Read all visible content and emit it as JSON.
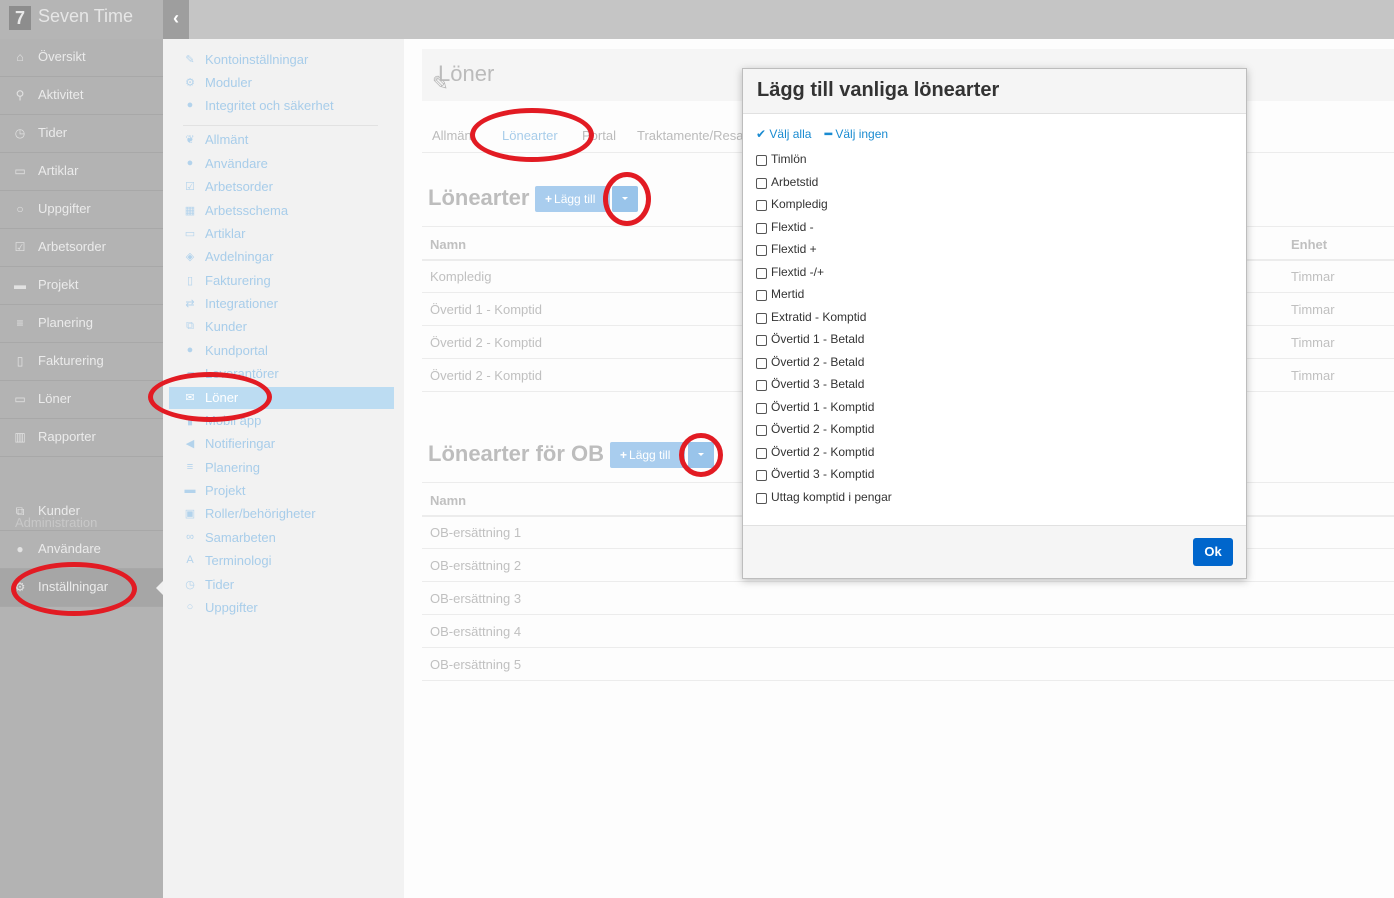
{
  "app": {
    "logo_mark": "7",
    "name": "Seven Time",
    "collapse_icon": "chevron-left-icon"
  },
  "leftnav": {
    "items": [
      {
        "label": "Översikt",
        "icon": "home-icon",
        "glyph": "⌂"
      },
      {
        "label": "Aktivitet",
        "icon": "map-marker-icon",
        "glyph": "⚲"
      },
      {
        "label": "Tider",
        "icon": "clock-icon",
        "glyph": "◷"
      },
      {
        "label": "Artiklar",
        "icon": "money-icon",
        "glyph": "▭"
      },
      {
        "label": "Uppgifter",
        "icon": "circle-icon",
        "glyph": "○"
      },
      {
        "label": "Arbetsorder",
        "icon": "check-square-icon",
        "glyph": "☑"
      },
      {
        "label": "Projekt",
        "icon": "briefcase-icon",
        "glyph": "▬"
      },
      {
        "label": "Planering",
        "icon": "list-icon",
        "glyph": "≡"
      },
      {
        "label": "Fakturering",
        "icon": "file-icon",
        "glyph": "▯"
      },
      {
        "label": "Löner",
        "icon": "money-icon",
        "glyph": "▭"
      },
      {
        "label": "Rapporter",
        "icon": "bar-chart-icon",
        "glyph": "▥"
      }
    ],
    "admin_title": "Administration",
    "admin_items": [
      {
        "label": "Kunder",
        "icon": "sitemap-icon",
        "glyph": "⧉"
      },
      {
        "label": "Användare",
        "icon": "user-icon",
        "glyph": "●"
      },
      {
        "label": "Inställningar",
        "icon": "gear-icon",
        "glyph": "⚙"
      }
    ]
  },
  "settings_menu": {
    "items": [
      {
        "label": "Kontoinställningar",
        "icon": "wrench-icon",
        "glyph": "✎"
      },
      {
        "label": "Moduler",
        "icon": "cogs-icon",
        "glyph": "⚙"
      },
      {
        "label": "Integritet och säkerhet",
        "icon": "circle-icon",
        "glyph": "●"
      },
      {
        "label": "Allmänt",
        "icon": "leaf-icon",
        "glyph": "❦"
      },
      {
        "label": "Användare",
        "icon": "user-icon",
        "glyph": "●"
      },
      {
        "label": "Arbetsorder",
        "icon": "check-square-icon",
        "glyph": "☑"
      },
      {
        "label": "Arbetsschema",
        "icon": "calendar-icon",
        "glyph": "▦"
      },
      {
        "label": "Artiklar",
        "icon": "money-icon",
        "glyph": "▭"
      },
      {
        "label": "Avdelningar",
        "icon": "tag-icon",
        "glyph": "◈"
      },
      {
        "label": "Fakturering",
        "icon": "file-icon",
        "glyph": "▯"
      },
      {
        "label": "Integrationer",
        "icon": "exchange-icon",
        "glyph": "⇄"
      },
      {
        "label": "Kunder",
        "icon": "sitemap-icon",
        "glyph": "⧉"
      },
      {
        "label": "Kundportal",
        "icon": "users-icon",
        "glyph": "●"
      },
      {
        "label": "Leverantörer",
        "icon": "truck-icon",
        "glyph": "▰"
      },
      {
        "label": "Löner",
        "icon": "envelope-icon",
        "glyph": "✉"
      },
      {
        "label": "Mobil app",
        "icon": "mobile-icon",
        "glyph": "▮"
      },
      {
        "label": "Notifieringar",
        "icon": "bullhorn-icon",
        "glyph": "◀"
      },
      {
        "label": "Planering",
        "icon": "list-icon",
        "glyph": "≡"
      },
      {
        "label": "Projekt",
        "icon": "briefcase-icon",
        "glyph": "▬"
      },
      {
        "label": "Roller/behörigheter",
        "icon": "lock-icon",
        "glyph": "▣"
      },
      {
        "label": "Samarbeten",
        "icon": "handshake-icon",
        "glyph": "∞"
      },
      {
        "label": "Terminologi",
        "icon": "font-icon",
        "glyph": "A"
      },
      {
        "label": "Tider",
        "icon": "clock-icon",
        "glyph": "◷"
      },
      {
        "label": "Uppgifter",
        "icon": "circle-icon",
        "glyph": "○"
      }
    ]
  },
  "main": {
    "title": "Löner",
    "tabs": [
      "Allmänt",
      "Lönearter",
      "Portal",
      "Traktamente/Resa"
    ],
    "section1": {
      "title": "Lönearter",
      "add_label": "Lägg till",
      "columns": {
        "name": "Namn",
        "unit": "Enhet"
      },
      "rows": [
        {
          "name": "Kompledig",
          "unit": "Timmar"
        },
        {
          "name": "Övertid 1 - Komptid",
          "unit": "Timmar"
        },
        {
          "name": "Övertid 2 - Komptid",
          "unit": "Timmar"
        },
        {
          "name": "Övertid 2 - Komptid",
          "unit": "Timmar"
        }
      ]
    },
    "section2": {
      "title": "Lönearter för OB",
      "add_label": "Lägg till",
      "columns": {
        "name": "Namn"
      },
      "rows": [
        "OB-ersättning 1",
        "OB-ersättning 2",
        "OB-ersättning 3",
        "OB-ersättning 4",
        "OB-ersättning 5"
      ]
    }
  },
  "modal": {
    "title": "Lägg till vanliga lönearter",
    "select_all": "Välj alla",
    "select_none": "Välj ingen",
    "options": [
      "Timlön",
      "Arbetstid",
      "Kompledig",
      "Flextid -",
      "Flextid +",
      "Flextid -/+",
      "Mertid",
      "Extratid - Komptid",
      "Övertid 1 - Betald",
      "Övertid 2 - Betald",
      "Övertid 3 - Betald",
      "Övertid 1 - Komptid",
      "Övertid 2 - Komptid",
      "Övertid 2 - Komptid",
      "Övertid 3 - Komptid",
      "Uttag komptid i pengar"
    ],
    "ok_label": "Ok"
  },
  "colors": {
    "annotation_ring": "#e21b23",
    "primary_button": "#0066cc",
    "link": "#1a8bd1"
  }
}
